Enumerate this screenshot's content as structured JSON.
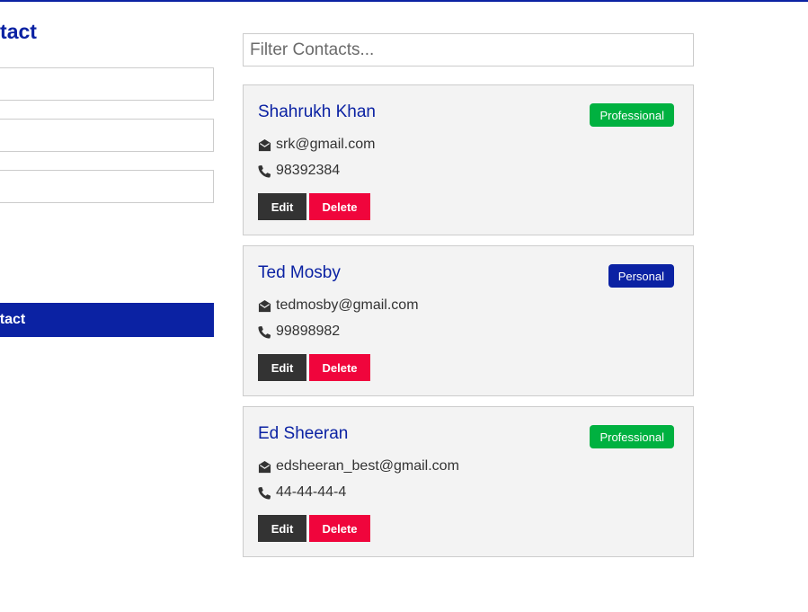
{
  "form": {
    "title": "ntact",
    "submit_label": "ntact"
  },
  "filter": {
    "placeholder": "Filter Contacts..."
  },
  "contacts": [
    {
      "name": "Shahrukh Khan",
      "email": "srk@gmail.com",
      "phone": "98392384",
      "type": "Professional",
      "type_color": "#00b140"
    },
    {
      "name": "Ted Mosby",
      "email": "tedmosby@gmail.com",
      "phone": "99898982",
      "type": "Personal",
      "type_color": "#0b22a3"
    },
    {
      "name": "Ed Sheeran",
      "email": "edsheeran_best@gmail.com",
      "phone": "44-44-44-4",
      "type": "Professional",
      "type_color": "#00b140"
    }
  ],
  "buttons": {
    "edit_label": "Edit",
    "delete_label": "Delete"
  },
  "icons": {
    "email": "envelope-open-icon",
    "phone": "phone-icon"
  },
  "colors": {
    "primary": "#0b22a3",
    "professional": "#00b140",
    "personal": "#0b22a3",
    "delete": "#f0053c",
    "edit": "#333333"
  }
}
